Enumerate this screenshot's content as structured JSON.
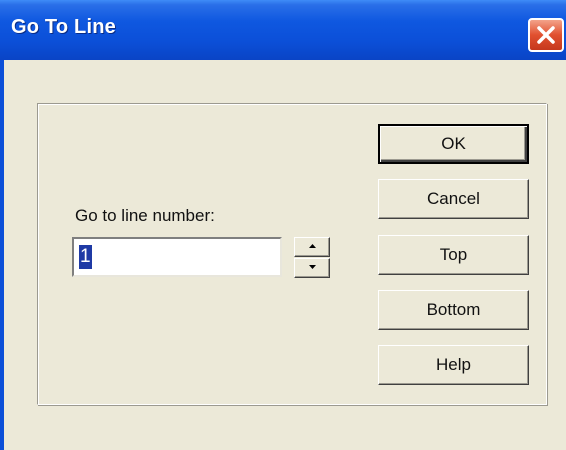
{
  "window": {
    "title": "Go To Line"
  },
  "form": {
    "label": "Go to line number:",
    "line_number_value": "1",
    "spinner_up_icon": "up-arrow-icon",
    "spinner_down_icon": "down-arrow-icon"
  },
  "buttons": {
    "ok": "OK",
    "cancel": "Cancel",
    "top": "Top",
    "bottom": "Bottom",
    "help": "Help"
  },
  "colors": {
    "titlebar": "#0b4fd8",
    "dialog_background": "#ece9d8",
    "close_button": "#e1502f",
    "selection": "#1f3aa5"
  }
}
